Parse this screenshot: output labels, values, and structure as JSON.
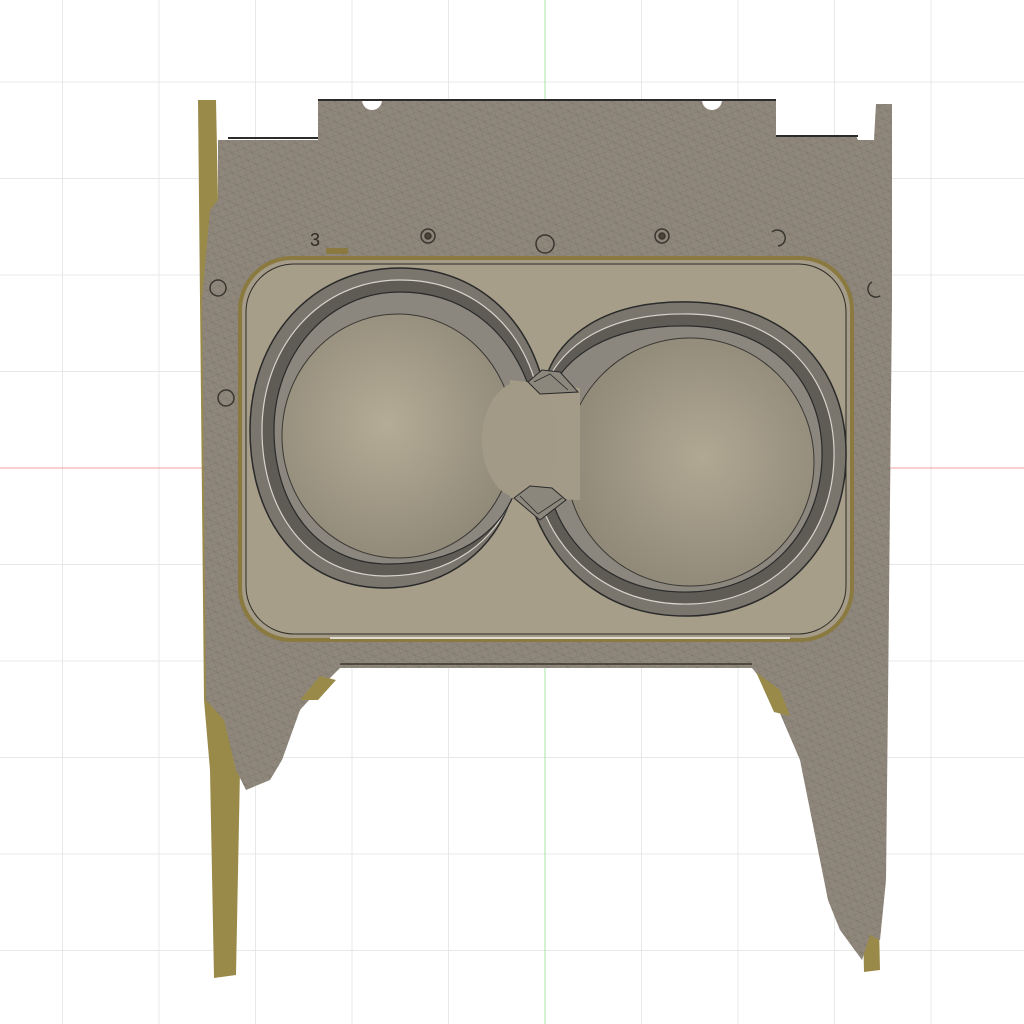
{
  "viewport": {
    "background": "#ffffff",
    "grid_color": "#e6e6e6",
    "x_axis_color": "#f08080",
    "y_axis_color": "#8fe08f"
  },
  "model": {
    "body_color": "#8f877a",
    "mesh_color": "#6f685e",
    "recess_color": "#a59c88",
    "cup_floor_color": "#a89f8a",
    "cup_wall_color": "#6e6a62",
    "scan_edge_color": "#9a8540",
    "outline_color": "#2a2a2a",
    "panel_number_label": "3"
  }
}
